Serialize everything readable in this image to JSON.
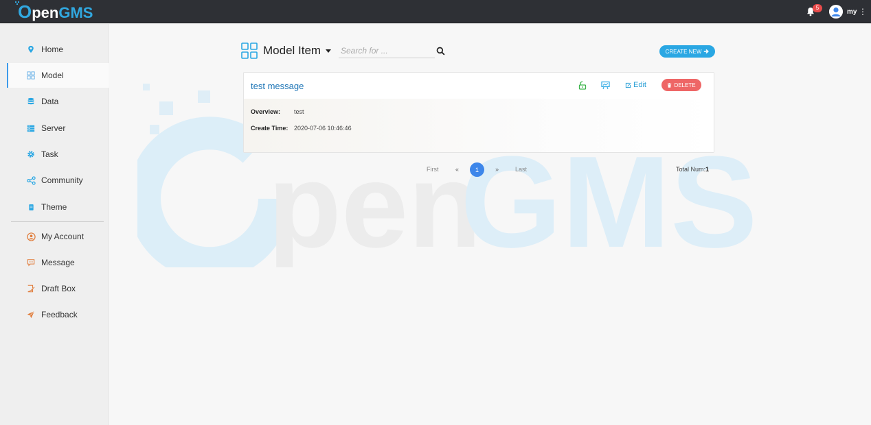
{
  "app": {
    "logo_o": "O",
    "logo_pen": "pen",
    "logo_gms": "GMS",
    "notification_count": "5",
    "username": "my",
    "menu_glyph": "⋮"
  },
  "sidebar": {
    "items": [
      {
        "label": "Home",
        "icon": "map-marker-icon"
      },
      {
        "label": "Model",
        "icon": "grid-icon"
      },
      {
        "label": "Data",
        "icon": "database-icon"
      },
      {
        "label": "Server",
        "icon": "server-icon"
      },
      {
        "label": "Task",
        "icon": "gear-icon"
      },
      {
        "label": "Community",
        "icon": "share-icon"
      },
      {
        "label": "Theme",
        "icon": "book-icon"
      },
      {
        "label": "My Account",
        "icon": "account-icon"
      },
      {
        "label": "Message",
        "icon": "message-icon"
      },
      {
        "label": "Draft Box",
        "icon": "draft-icon"
      },
      {
        "label": "Feedback",
        "icon": "send-icon"
      }
    ],
    "active": "Model"
  },
  "header": {
    "title": "Model Item",
    "search_placeholder": "Search for ...",
    "create_label": "CREATE NEW"
  },
  "card": {
    "title": "test message",
    "edit_label": "Edit",
    "delete_label": "DELETE",
    "overview_label": "Overview:",
    "overview_value": "test",
    "create_time_label": "Create Time:",
    "create_time_value": "2020-07-06 10:46:46"
  },
  "pagination": {
    "first": "First",
    "prev": "«",
    "current": "1",
    "next": "»",
    "last": "Last",
    "total_label": "Total Num:",
    "total_value": "1"
  },
  "colors": {
    "topbar": "#2e3035",
    "brand_blue": "#31a8e0",
    "accent_blue": "#3d86ea",
    "delete_red": "#ee6666",
    "title_blue": "#1a73b5"
  }
}
